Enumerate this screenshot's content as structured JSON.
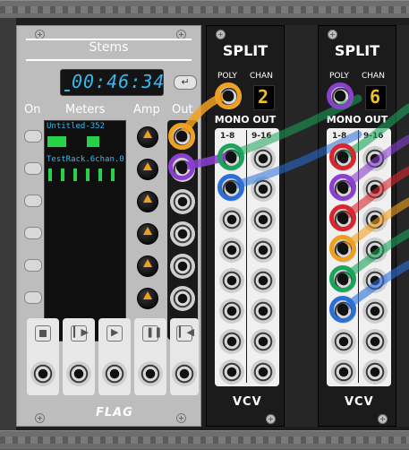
{
  "stems": {
    "title": "Stems",
    "time": "00:46:34",
    "labels": {
      "on": "On",
      "meters": "Meters",
      "amp": "Amp",
      "out": "Out"
    },
    "tracks": [
      "Untitled-352",
      "TestRack.6chan.0"
    ],
    "footer_logo": "FLAG"
  },
  "split": [
    {
      "title": "SPLIT",
      "poly_label": "POLY",
      "chan_label": "CHAN",
      "chan_value": "2",
      "mono_out_label": "MONO OUT",
      "col1": "1-8",
      "col2": "9-16",
      "logo": "VCV"
    },
    {
      "title": "SPLIT",
      "poly_label": "POLY",
      "chan_label": "CHAN",
      "chan_value": "6",
      "mono_out_label": "MONO OUT",
      "col1": "1-8",
      "col2": "9-16",
      "logo": "VCV"
    }
  ],
  "colors": {
    "orange": "#f0a020",
    "purple": "#8a3fd0",
    "green": "#1aa45a",
    "blue": "#2a6fd8",
    "red": "#d8262e",
    "display_cyan": "#34b8f0",
    "meter_green": "#27d14a"
  }
}
